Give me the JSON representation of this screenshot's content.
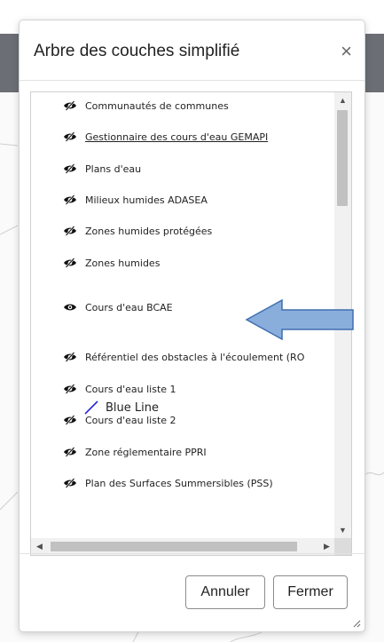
{
  "dialog": {
    "title": "Arbre des couches simplifié",
    "close_glyph": "×"
  },
  "layers": [
    {
      "label": "Communautés de communes",
      "visible": false,
      "link": false
    },
    {
      "label": "Gestionnaire des cours d'eau GEMAPI",
      "visible": false,
      "link": true
    },
    {
      "label": "Plans d'eau",
      "visible": false,
      "link": false
    },
    {
      "label": "Milieux humides ADASEA",
      "visible": false,
      "link": false
    },
    {
      "label": "Zones humides protégées",
      "visible": false,
      "link": false
    },
    {
      "label": "Zones humides",
      "visible": false,
      "link": false
    },
    {
      "label": "Cours d'eau BCAE",
      "visible": true,
      "link": false
    },
    {
      "label": "Référentiel des obstacles à l'écoulement (RO",
      "visible": false,
      "link": false
    },
    {
      "label": "Cours d'eau liste 1",
      "visible": false,
      "link": false
    },
    {
      "label": "Cours d'eau liste 2",
      "visible": false,
      "link": false
    },
    {
      "label": "Zone réglementaire PPRI",
      "visible": false,
      "link": false
    },
    {
      "label": "Plan des Surfaces Summersibles (PSS)",
      "visible": false,
      "link": false
    }
  ],
  "legend": {
    "label": "Blue Line",
    "line_color": "#2a2ad6"
  },
  "footer": {
    "cancel_label": "Annuler",
    "close_label": "Fermer"
  },
  "colors": {
    "callout_fill": "#8aaedc",
    "callout_stroke": "#3f6fb0",
    "header_bg": "#6b6f75"
  },
  "icons": {
    "eye_open": "eye-icon",
    "eye_hidden": "eye-slash-icon"
  }
}
